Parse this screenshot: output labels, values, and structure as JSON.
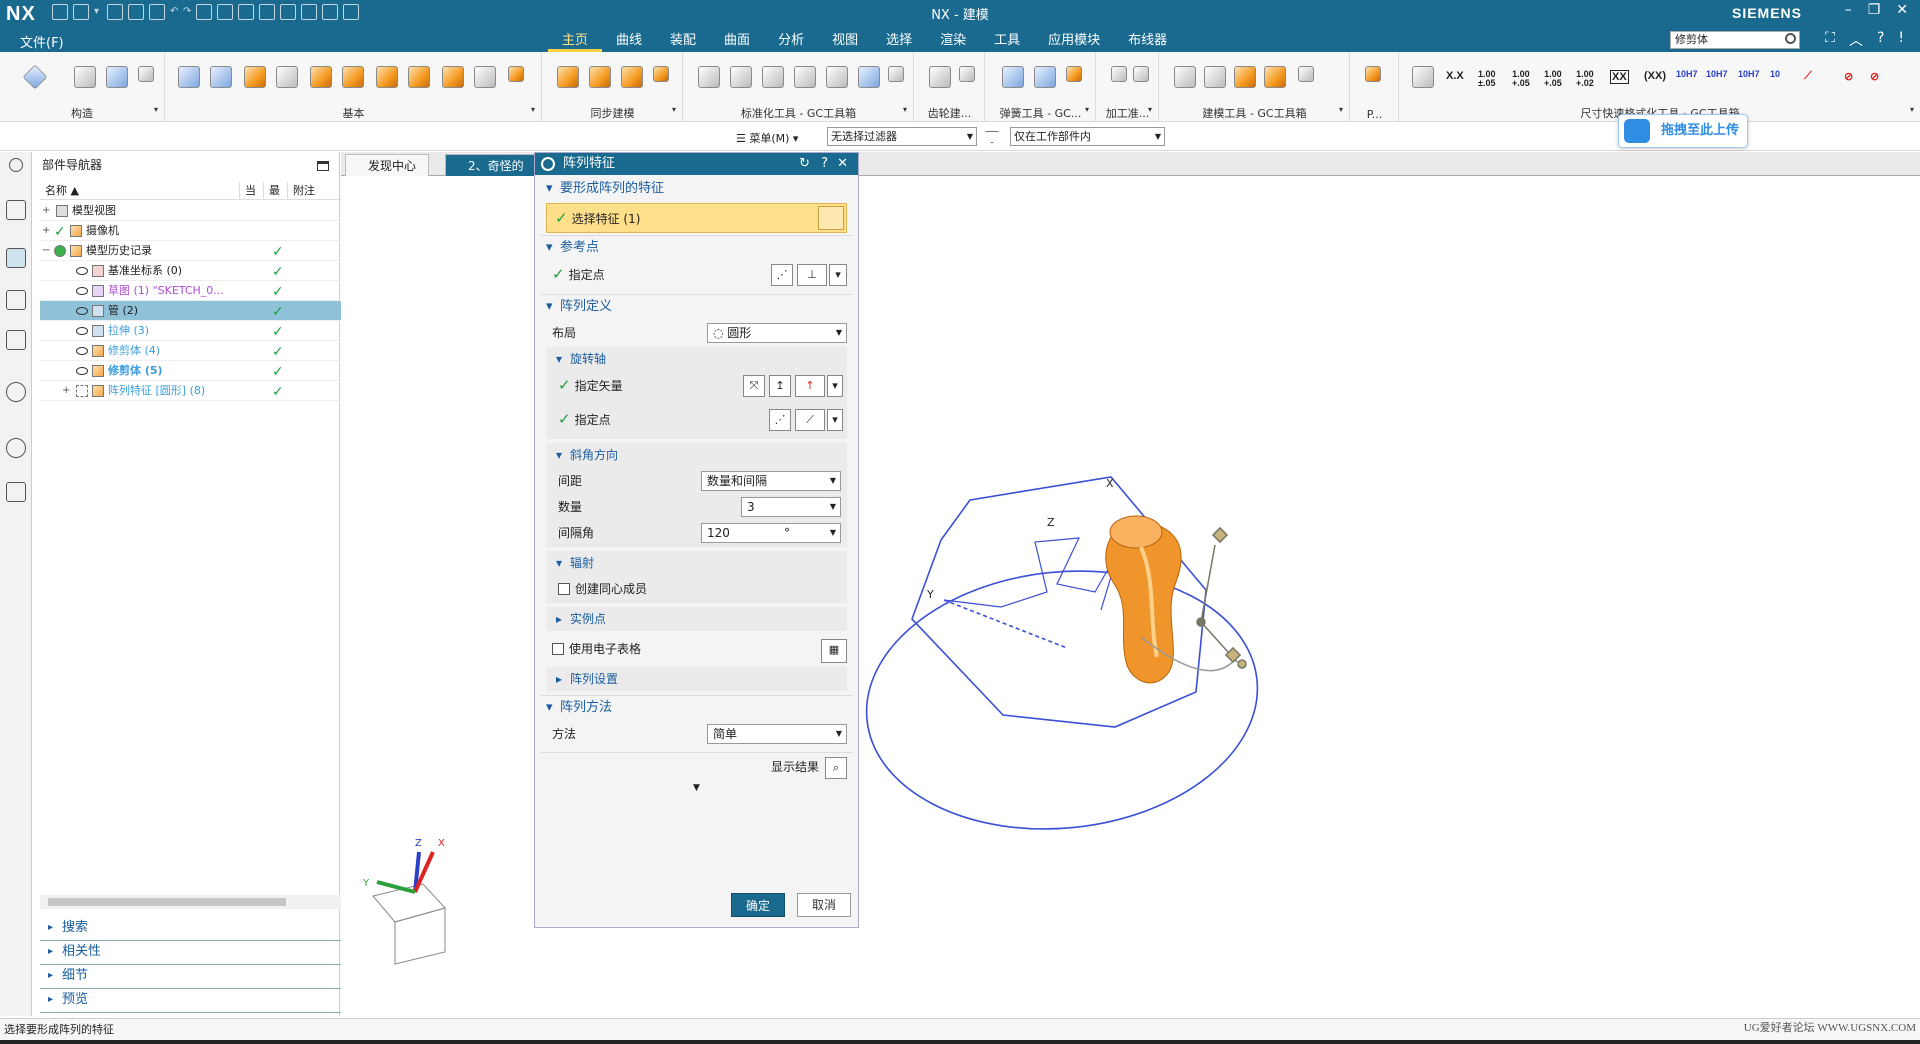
{
  "app": {
    "logo": "NX",
    "title": "NX - 建模",
    "brand": "SIEMENS"
  },
  "menu": {
    "file": "文件(F)",
    "tabs": [
      "主页",
      "曲线",
      "装配",
      "曲面",
      "分析",
      "视图",
      "选择",
      "渲染",
      "工具",
      "应用模块",
      "布线器"
    ],
    "search_value": "修剪体"
  },
  "ribbon": {
    "groups": [
      "构造",
      "基本",
      "同步建模",
      "标准化工具 - GC工具箱",
      "齿轮建...",
      "弹簧工具 - GC...",
      "加工准...",
      "建模工具 - GC工具箱",
      "P...",
      "尺寸快速格式化工具 - GC工具箱"
    ]
  },
  "filterbar": {
    "menu": "菜单(M)",
    "filter": "无选择过滤器",
    "scope": "仅在工作部件内"
  },
  "upload": {
    "label": "拖拽至此上传"
  },
  "navigator": {
    "title": "部件导航器",
    "columns": [
      "名称",
      "当",
      "最",
      "附注"
    ],
    "rows": [
      {
        "label": "模型视图",
        "expand": "+"
      },
      {
        "label": "摄像机",
        "expand": "+"
      },
      {
        "label": "模型历史记录",
        "expand": "−"
      },
      {
        "label": "基准坐标系 (0)"
      },
      {
        "label": "草图 (1) \"SKETCH_0..."
      },
      {
        "label": "管 (2)"
      },
      {
        "label": "拉伸 (3)"
      },
      {
        "label": "修剪体 (4)"
      },
      {
        "label": "修剪体 (5)"
      },
      {
        "label": "阵列特征 [圆形] (8)",
        "expand": "+"
      }
    ],
    "sections": [
      "搜索",
      "相关性",
      "细节",
      "预览"
    ]
  },
  "doctabs": [
    "发现中心",
    "2、奇怪的"
  ],
  "dialog": {
    "title": "阵列特征",
    "sec_features": "要形成阵列的特征",
    "select_feature": "选择特征 (1)",
    "sec_refpoint": "参考点",
    "specify_point": "指定点",
    "sec_arraydef": "阵列定义",
    "layout_label": "布局",
    "layout_value": "圆形",
    "sub_axis": "旋转轴",
    "specify_vector": "指定矢量",
    "specify_point2": "指定点",
    "sub_angle": "斜角方向",
    "spacing_label": "间距",
    "spacing_value": "数量和间隔",
    "count_label": "数量",
    "count_value": "3",
    "pitch_label": "间隔角",
    "pitch_value": "120",
    "pitch_unit": "°",
    "sub_radiate": "辐射",
    "concentric": "创建同心成员",
    "instance_pts": "实例点",
    "use_sheet": "使用电子表格",
    "array_settings": "阵列设置",
    "sec_method": "阵列方法",
    "method_label": "方法",
    "method_value": "简单",
    "show_result": "显示结果",
    "ok": "确定",
    "cancel": "取消"
  },
  "status": {
    "text": "选择要形成阵列的特征",
    "watermark": "UG爱好者论坛 WWW.UGSNX.COM"
  },
  "colors": {
    "titlebar": "#1a6a8f",
    "accent": "#ffd24a",
    "check": "#1e9f3a",
    "wire": "#3a4fd6",
    "part": "#f0952b"
  }
}
